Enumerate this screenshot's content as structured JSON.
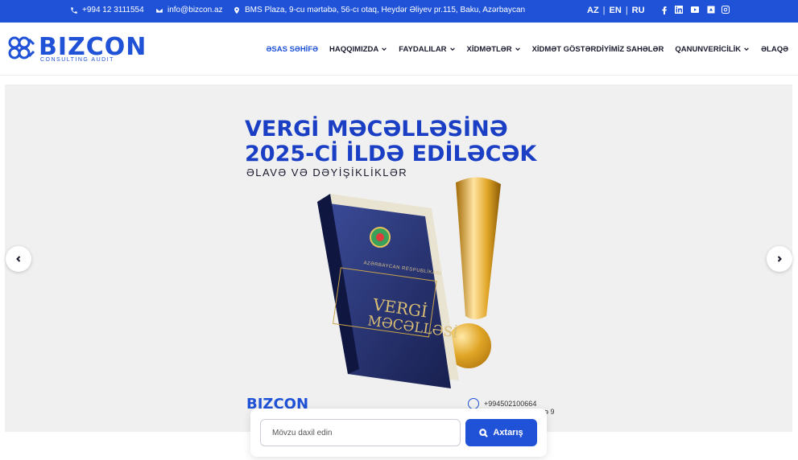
{
  "topbar": {
    "phone": "+994 12 3111554",
    "email": "info@bizcon.az",
    "address": "BMS Plaza, 9-cu mərtəbə, 56-cı otaq, Heydər Əliyev pr.115, Baku, Azərbaycan",
    "languages": [
      "AZ",
      "EN",
      "RU"
    ],
    "social": [
      "facebook-icon",
      "linkedin-icon",
      "youtube-icon",
      "app-icon",
      "instagram-icon"
    ],
    "bg_color": "#1f52d6"
  },
  "logo": {
    "name": "BIZCON",
    "tagline": "CONSULTING AUDIT"
  },
  "nav": [
    {
      "label": "ƏSAS SƏHİFƏ",
      "active": true,
      "dropdown": false
    },
    {
      "label": "HAQQIMIZDA",
      "active": false,
      "dropdown": true
    },
    {
      "label": "FAYDALILAR",
      "active": false,
      "dropdown": true
    },
    {
      "label": "XİDMƏTLƏR",
      "active": false,
      "dropdown": true
    },
    {
      "label": "XİDMƏT GÖSTƏRDİYİMİZ SAHƏLƏR",
      "active": false,
      "dropdown": false
    },
    {
      "label": "QANUNVERİCİLİK",
      "active": false,
      "dropdown": true
    },
    {
      "label": "ƏLAQƏ",
      "active": false,
      "dropdown": false
    }
  ],
  "hero": {
    "title_line1": "VERGİ MƏCƏLLƏSİNƏ",
    "title_line2": "2025-Cİ İLDƏ EDİLƏCƏK",
    "subtitle": "ƏLAVƏ VƏ DƏYİŞİKLİKLƏR",
    "book_header": "AZƏRBAYCAN RESPUBLİKASI",
    "book_title_1": "VERGİ",
    "book_title_2": "MƏCƏLLƏSİ",
    "logo_text": "BIZCON",
    "phone": "+994502100664",
    "address_fragment": "bə 9"
  },
  "search": {
    "placeholder": "Mövzu daxil edin",
    "button_label": "Axtarış"
  }
}
